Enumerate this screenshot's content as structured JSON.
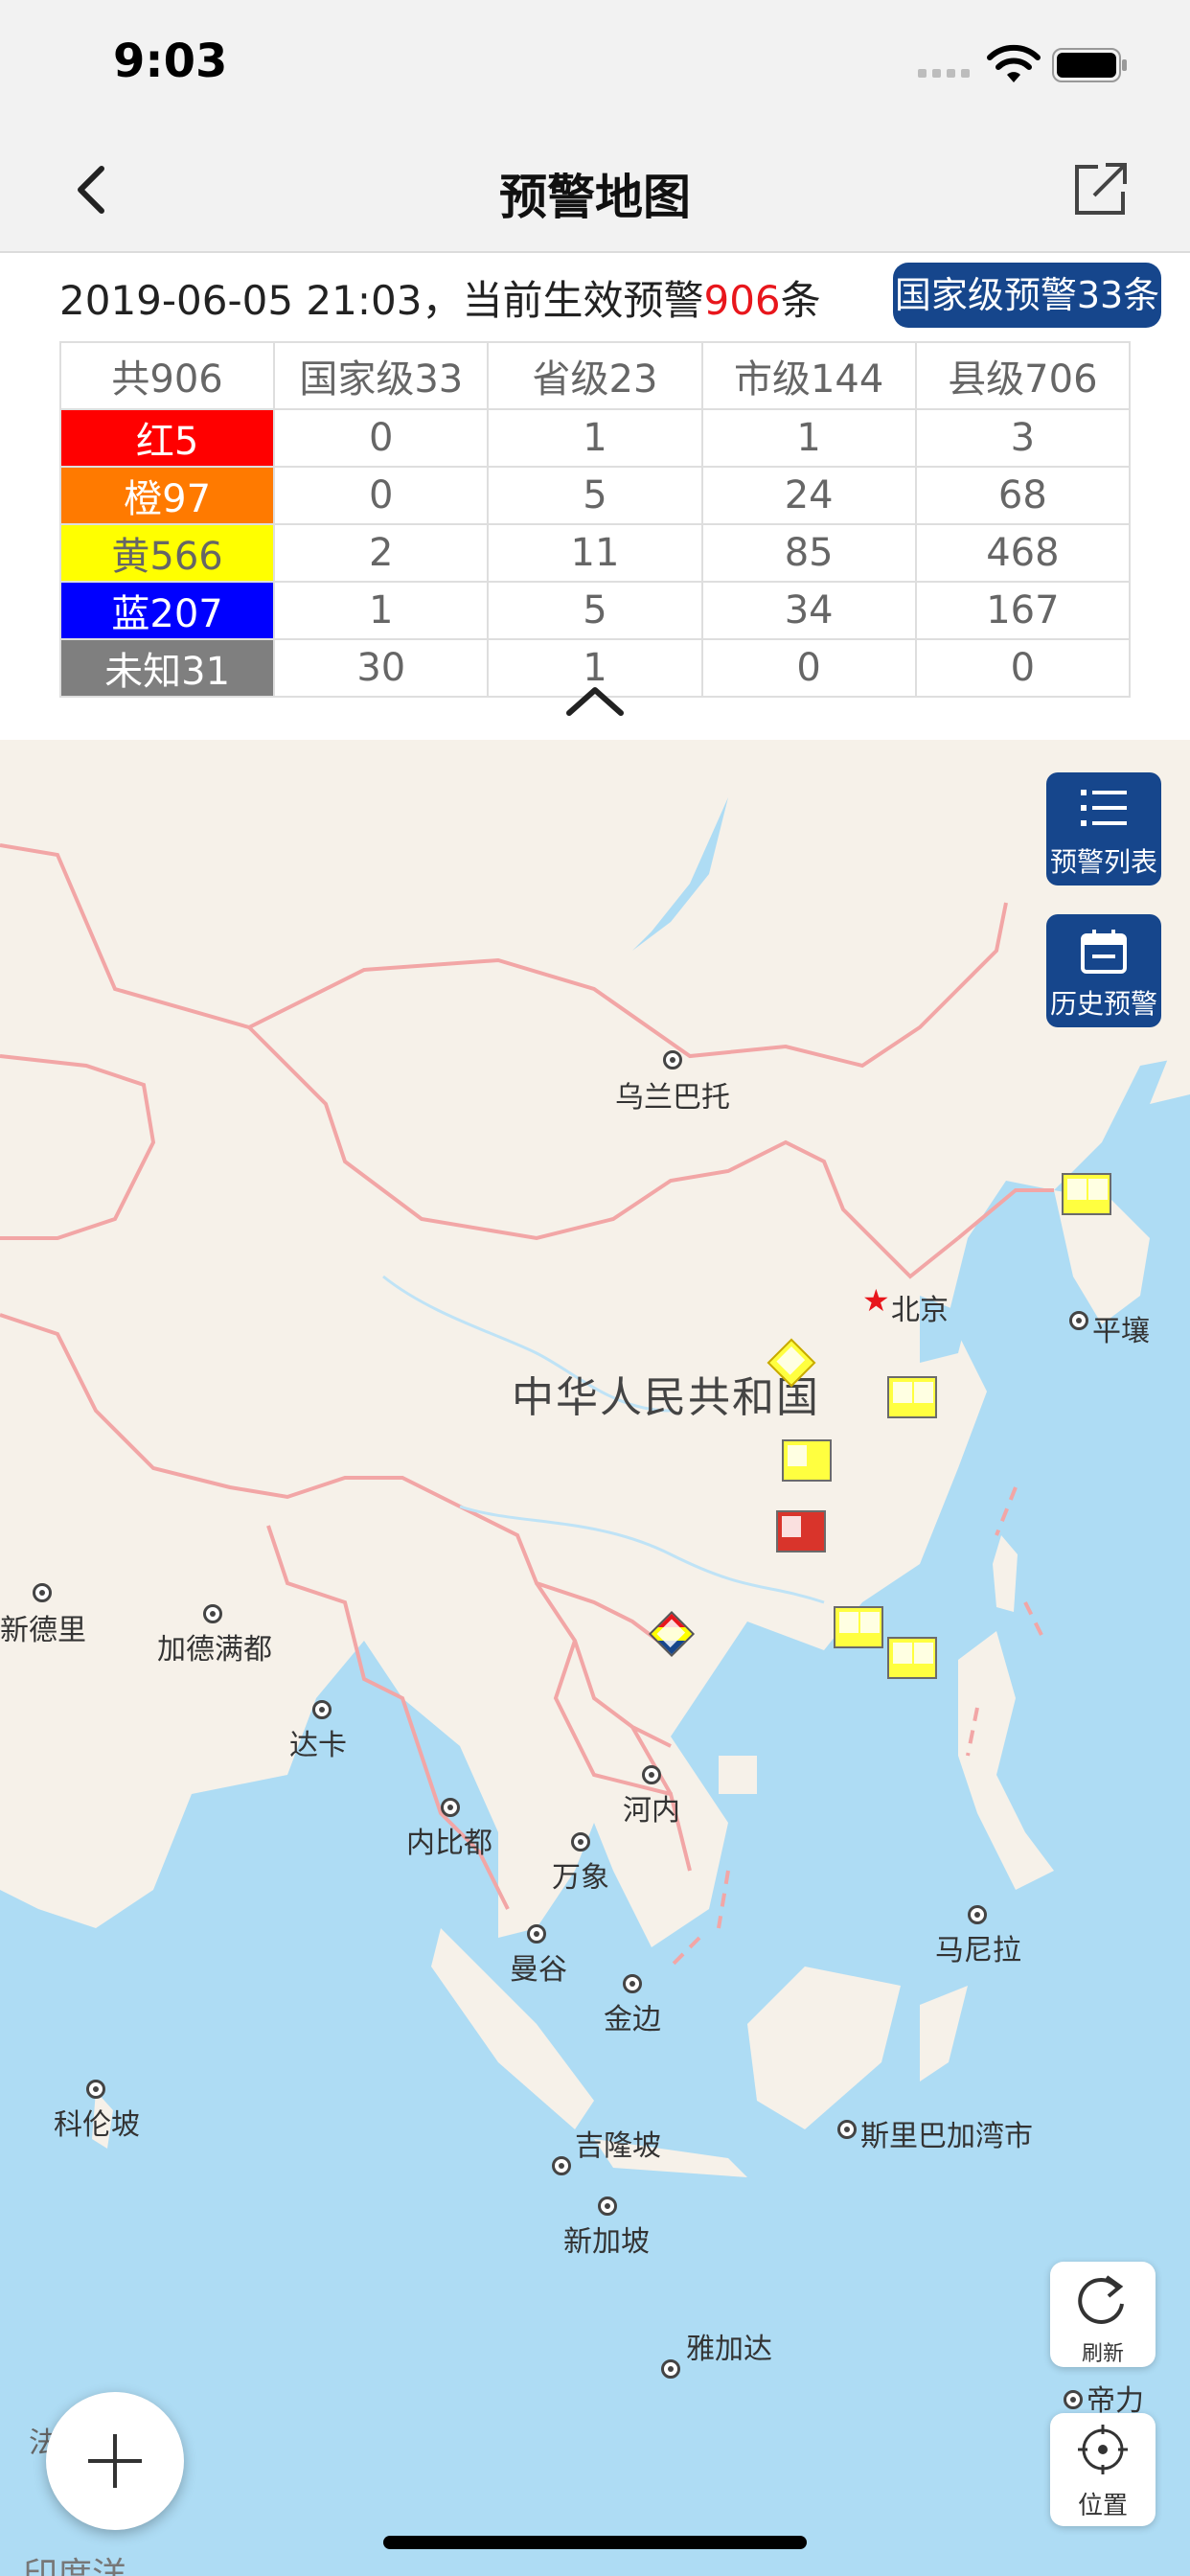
{
  "status_bar": {
    "time": "9:03"
  },
  "nav": {
    "title": "预警地图",
    "back_icon": "chevron-left-icon",
    "share_icon": "share-icon"
  },
  "summary": {
    "datetime": "2019-06-05 21:03，当前生效预警",
    "count": "906",
    "suffix": "条",
    "national_badge": "国家级预警33条"
  },
  "table": {
    "headers": [
      "共906",
      "国家级33",
      "省级23",
      "市级144",
      "县级706"
    ],
    "rows": [
      {
        "level": "红5",
        "values": [
          "0",
          "1",
          "1",
          "3"
        ]
      },
      {
        "level": "橙97",
        "values": [
          "0",
          "5",
          "24",
          "68"
        ]
      },
      {
        "level": "黄566",
        "values": [
          "2",
          "11",
          "85",
          "468"
        ]
      },
      {
        "level": "蓝207",
        "values": [
          "1",
          "5",
          "34",
          "167"
        ]
      },
      {
        "level": "未知31",
        "values": [
          "30",
          "1",
          "0",
          "0"
        ]
      }
    ]
  },
  "colors": {
    "red": "#ff0000",
    "orange": "#ff7a00",
    "yellow": "#ffff00",
    "blue": "#0000ff",
    "unknown": "#7f7f7f",
    "accent": "#16468c",
    "highlight": "#e8161c"
  },
  "map": {
    "country": "中华人民共和国",
    "cities": [
      "乌兰巴托",
      "北京",
      "平壤",
      "新德里",
      "加德满都",
      "达卡",
      "河内",
      "内比都",
      "万象",
      "曼谷",
      "金边",
      "马尼拉",
      "科伦坡",
      "吉隆坡",
      "新加坡",
      "斯里巴加湾市",
      "雅加达",
      "帝力",
      "法",
      "印度洋"
    ]
  },
  "side_buttons": {
    "list_label": "预警列表",
    "history_label": "历史预警"
  },
  "tools": {
    "refresh_label": "刷新",
    "locate_label": "位置"
  }
}
